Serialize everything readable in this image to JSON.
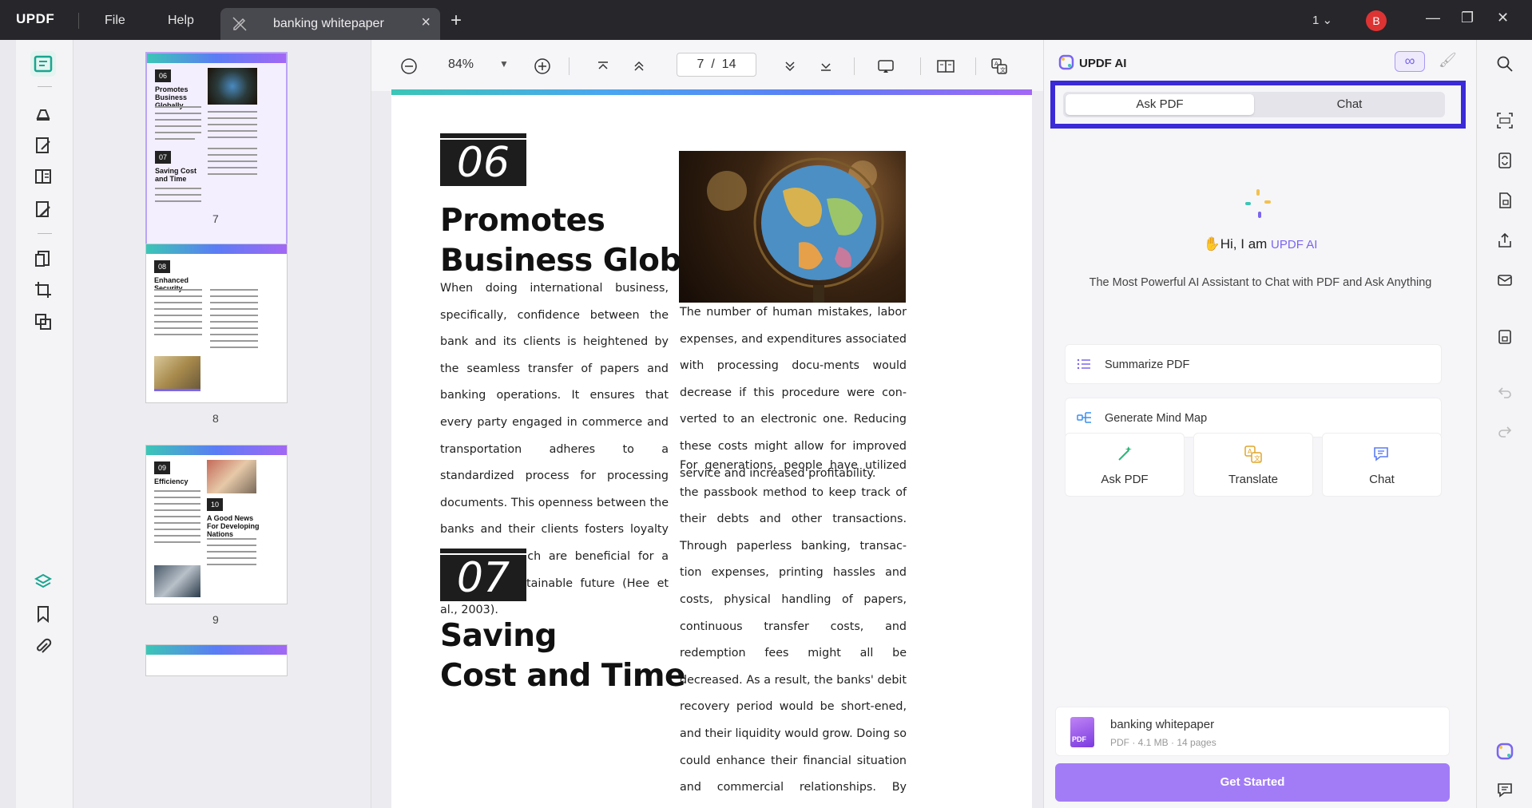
{
  "app": {
    "logo": "UPDF",
    "menu": {
      "file": "File",
      "help": "Help"
    },
    "tab_title": "banking whitepaper",
    "window_count": "1",
    "user_initial": "B"
  },
  "toolbar": {
    "zoom": "84%",
    "current_page": "7",
    "page_separator": "/",
    "total_pages": "14"
  },
  "thumbnails": [
    {
      "page_label": "7",
      "selected": true
    },
    {
      "page_label": "8",
      "selected": false
    },
    {
      "page_label": "9",
      "selected": false
    }
  ],
  "thumb_text": {
    "p7": {
      "n1": "06",
      "t1": "Promotes Business Globally",
      "n2": "07",
      "t2": "Saving Cost and Time"
    },
    "p8": {
      "n1": "08",
      "t1": "Enhanced Security"
    },
    "p9": {
      "n1": "09",
      "t1": "Efficiency",
      "n2": "10",
      "t2": "A Good News For Developing Nations"
    }
  },
  "document": {
    "section1_number": "06",
    "section1_title_l1": "Promotes",
    "section1_title_l2": "Business Globally",
    "section1_body": "When doing international business, specifically, confidence between the bank and its clients is heightened by the seamless transfer of papers and banking operations. It ensures that every party engaged in commerce and transportation adheres to a standardized process for processing documents. This openness between the banks and their clients fosters loyalty and trust, which are beneficial for a long-term, sustainable future (Hee et al., 2003).",
    "right_para1": "The number of human mistakes, labor expenses, and expenditures associated with processing docu-ments would decrease if this procedure were con-verted to an electronic one. Reducing these costs might allow for improved service and increased profitability.",
    "right_para2": "For generations, people have utilized the passbook method to keep track of their debts and other transactions. Through paperless banking, transac-tion expenses, printing hassles and costs, physical handling of papers, continuous transfer costs, and redemption fees might all be decreased. As a result, the banks' debit recovery period would be short-ened, and their liquidity would grow. Doing so could enhance their financial situation and commercial relationships. By adopting paperless banking, the",
    "section2_number": "07",
    "section2_title_l1": "Saving",
    "section2_title_l2": "Cost and Time"
  },
  "ai_panel": {
    "title": "UPDF AI",
    "infinity_symbol": "∞",
    "tabs": [
      {
        "label": "Ask PDF",
        "active": true
      },
      {
        "label": "Chat",
        "active": false
      }
    ],
    "greeting_prefix": "Hi, I am ",
    "greeting_brand": "UPDF AI",
    "subtitle": "The Most Powerful AI Assistant to Chat with PDF and Ask Anything",
    "actions": [
      {
        "label": "Summarize PDF",
        "icon": "list-icon"
      },
      {
        "label": "Generate Mind Map",
        "icon": "mind-map-icon"
      }
    ],
    "cards": [
      {
        "label": "Ask PDF",
        "icon": "ask-pdf-icon"
      },
      {
        "label": "Translate",
        "icon": "translate-icon"
      },
      {
        "label": "Chat",
        "icon": "chat-icon"
      }
    ],
    "file": {
      "name": "banking whitepaper",
      "meta": "PDF · 4.1 MB · 14 pages",
      "badge": "PDF"
    },
    "cta": "Get Started"
  },
  "colors": {
    "accent": "#7a64f0",
    "highlight_frame": "#3a2ad8",
    "cta": "#a27cf7",
    "titlebar": "#26262b"
  }
}
